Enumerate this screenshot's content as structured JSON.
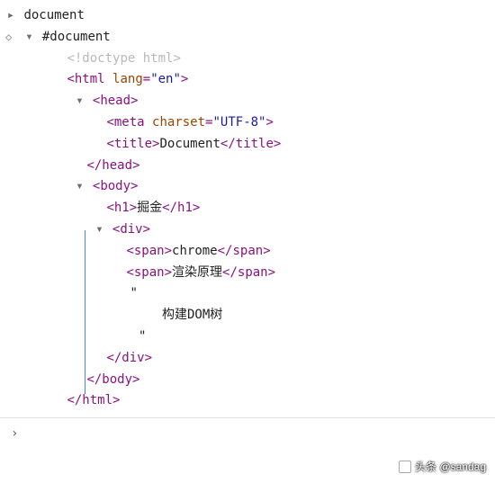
{
  "tree": {
    "root_label": "document",
    "doc_label": "#document",
    "doctype": "<!doctype html>",
    "html_open": {
      "tag": "html",
      "attr": "lang",
      "val": "\"en\""
    },
    "head_open": "head",
    "meta": {
      "tag": "meta",
      "attr": "charset",
      "val": "\"UTF-8\""
    },
    "title": {
      "tag": "title",
      "text": "Document"
    },
    "head_close": "/head",
    "body_open": "body",
    "h1": {
      "tag": "h1",
      "text": "掘金"
    },
    "div_open": "div",
    "span1": {
      "tag": "span",
      "text": "chrome"
    },
    "span2": {
      "tag": "span",
      "text": "渲染原理"
    },
    "quote1": "\"",
    "text_node": "构建DOM树",
    "quote2": "\"",
    "div_close": "/div",
    "body_close": "/body",
    "html_close": "/html"
  },
  "breadcrumb": {
    "chevron": "›"
  },
  "watermark": {
    "text": "头条 @sandag"
  }
}
